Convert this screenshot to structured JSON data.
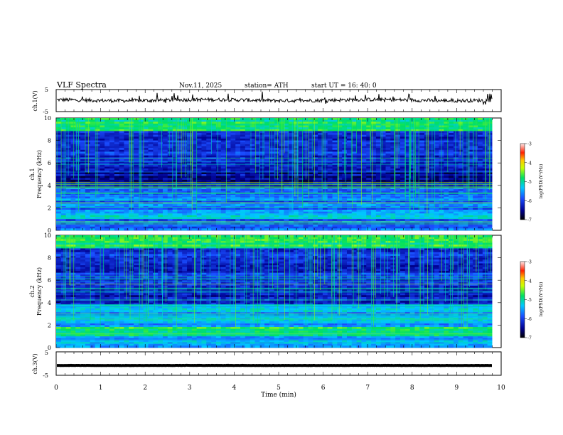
{
  "header": {
    "title": "VLF  Spectra",
    "date": "Nov.11, 2025",
    "station": "station= ATH",
    "start": "start  UT  =    16: 40: 0"
  },
  "chart_data": [
    {
      "type": "line",
      "name": "ch1-voltage",
      "ylabel": "ch.1(V)",
      "ylim": [
        -5,
        5
      ],
      "yticks": [
        "5",
        "-5"
      ],
      "baseline_mean": 0.2,
      "color": "#000000"
    },
    {
      "type": "heatmap",
      "name": "ch1-spectrogram",
      "ylabel_line1": "ch.1",
      "ylabel_line2": "Frequency (kHz)",
      "ylim": [
        0,
        10
      ],
      "yticks": [
        "0",
        "2",
        "4",
        "6",
        "8",
        "10"
      ],
      "xlim": [
        0,
        9.8
      ],
      "colorbar": {
        "label": "log(PSD)(V²/Hz)",
        "range": [
          -7,
          -3
        ],
        "ticks": [
          "-3",
          "-4",
          "-5",
          "-6",
          "-7"
        ]
      }
    },
    {
      "type": "heatmap",
      "name": "ch2-spectrogram",
      "ylabel_line1": "ch.2",
      "ylabel_line2": "Frequency (kHz)",
      "ylim": [
        0,
        10
      ],
      "yticks": [
        "0",
        "2",
        "4",
        "6",
        "8",
        "10"
      ],
      "xlim": [
        0,
        9.8
      ],
      "colorbar": {
        "label": "log(PSD)(V²/Hz)",
        "range": [
          -7,
          -3
        ],
        "ticks": [
          "-3",
          "-4",
          "-5",
          "-6",
          "-7"
        ]
      }
    },
    {
      "type": "line",
      "name": "ch3-voltage",
      "ylabel": "ch.3(V)",
      "ylim": [
        -5,
        5
      ],
      "yticks": [
        "5",
        "-5"
      ],
      "baseline_mean": -0.8,
      "color": "#000000"
    }
  ],
  "x_axis": {
    "label": "Time  (min)",
    "ticks": [
      "0",
      "1",
      "2",
      "3",
      "4",
      "5",
      "6",
      "7",
      "8",
      "9",
      "10"
    ],
    "xlim": [
      0,
      10
    ]
  }
}
